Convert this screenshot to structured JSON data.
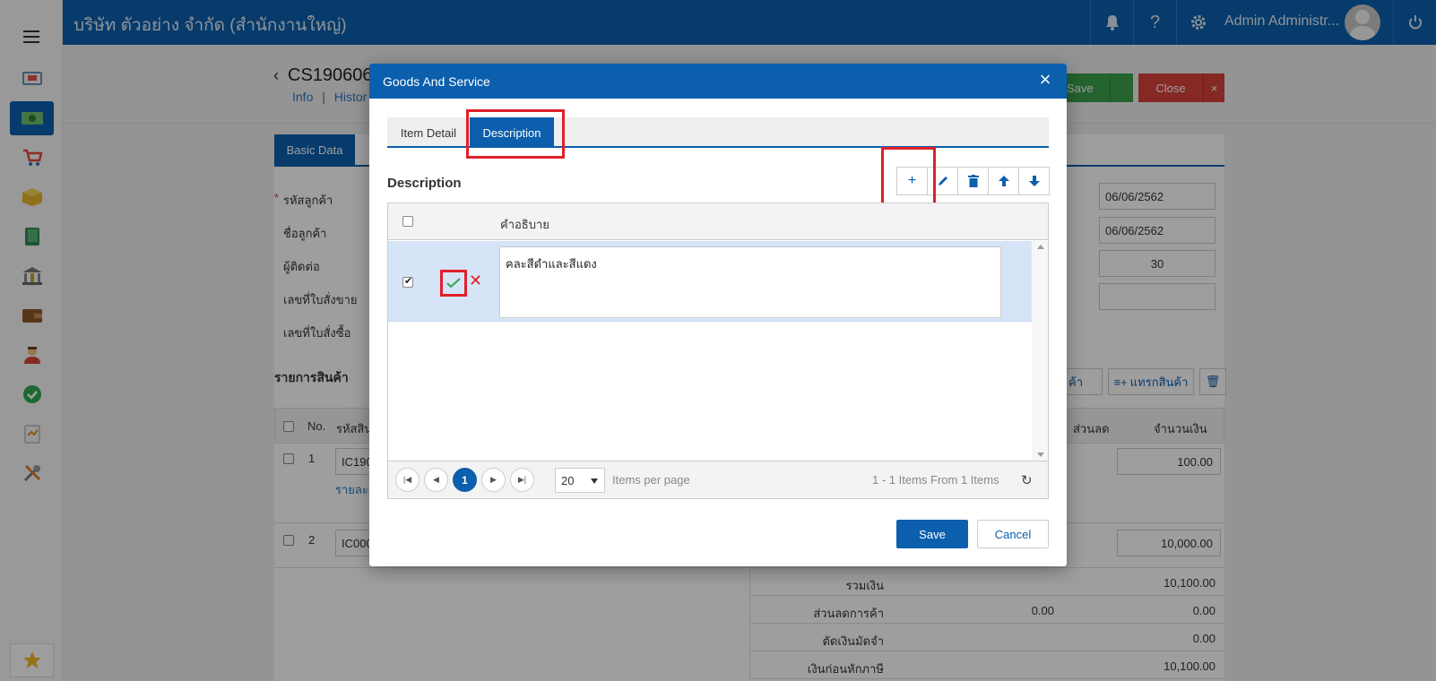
{
  "header": {
    "company": "บริษัท ตัวอย่าง จำกัด (สำนักงานใหญ่)",
    "user": "Admin Administr...",
    "icons": [
      "bell-icon",
      "help-icon",
      "gear-icon",
      "power-icon"
    ]
  },
  "sidebar": {
    "items": [
      "dashboard-icon",
      "money-icon",
      "cart-icon",
      "box-icon",
      "book-icon",
      "bank-icon",
      "wallet-icon",
      "person-icon",
      "check-icon",
      "report-icon",
      "tools-icon",
      "star-icon"
    ]
  },
  "document": {
    "title": "CS190606",
    "link_info": "Info",
    "link_separator": "|",
    "link_history": "Histor",
    "save_label": "Save",
    "close_label": "Close",
    "tab_basic": "Basic Data",
    "required_mark": "*",
    "labels": [
      "รหัสลูกค้า",
      "ชื่อลูกค้า",
      "ผู้ติดต่อ",
      "เลขที่ใบสั่งขาย",
      "เลขที่ใบสั่งซื้อ"
    ],
    "date1": "06/06/2562",
    "date2": "06/06/2562",
    "credit_days": "30",
    "items_section": "รายการสินค้า",
    "add_item_label": "ค้า",
    "insert_item_label": "แทรกสินค้า",
    "col_no": "No.",
    "col_code": "รหัสสิน",
    "col_discount": "ส่วนลด",
    "col_amount": "จำนวนเงิน",
    "rows": [
      {
        "no": "1",
        "code": "IC190",
        "sub": "รายละเ",
        "amount": "100.00"
      },
      {
        "no": "2",
        "code": "IC000",
        "amount": "10,000.00"
      }
    ],
    "summary": [
      {
        "label": "รวมเงิน",
        "value": "10,100.00"
      },
      {
        "label": "ส่วนลดการค้า",
        "mid": "0.00",
        "value": "0.00"
      },
      {
        "label": "ตัดเงินมัดจำ",
        "value": "0.00"
      },
      {
        "label": "เงินก่อนหักภาษี",
        "value": "10,100.00"
      }
    ]
  },
  "modal": {
    "title": "Goods And Service",
    "tabs": [
      {
        "label": "Item Detail",
        "active": false
      },
      {
        "label": "Description",
        "active": true
      }
    ],
    "section_title": "Description",
    "toolbar": [
      "add-icon",
      "edit-icon",
      "delete-icon",
      "move-up-icon",
      "move-down-icon"
    ],
    "grid": {
      "column": "คำอธิบาย",
      "rows": [
        {
          "checked": true,
          "text": "คละสีดำและสีแดง"
        }
      ]
    },
    "pager": {
      "current_page": "1",
      "page_size": "20",
      "items_per_page": "Items per page",
      "summary": "1 - 1 Items From 1 Items"
    },
    "save_label": "Save",
    "cancel_label": "Cancel"
  },
  "colors": {
    "primary": "#0b5fad",
    "highlight": "#e0202a",
    "success": "#3ca04d",
    "danger": "#d9413a"
  }
}
